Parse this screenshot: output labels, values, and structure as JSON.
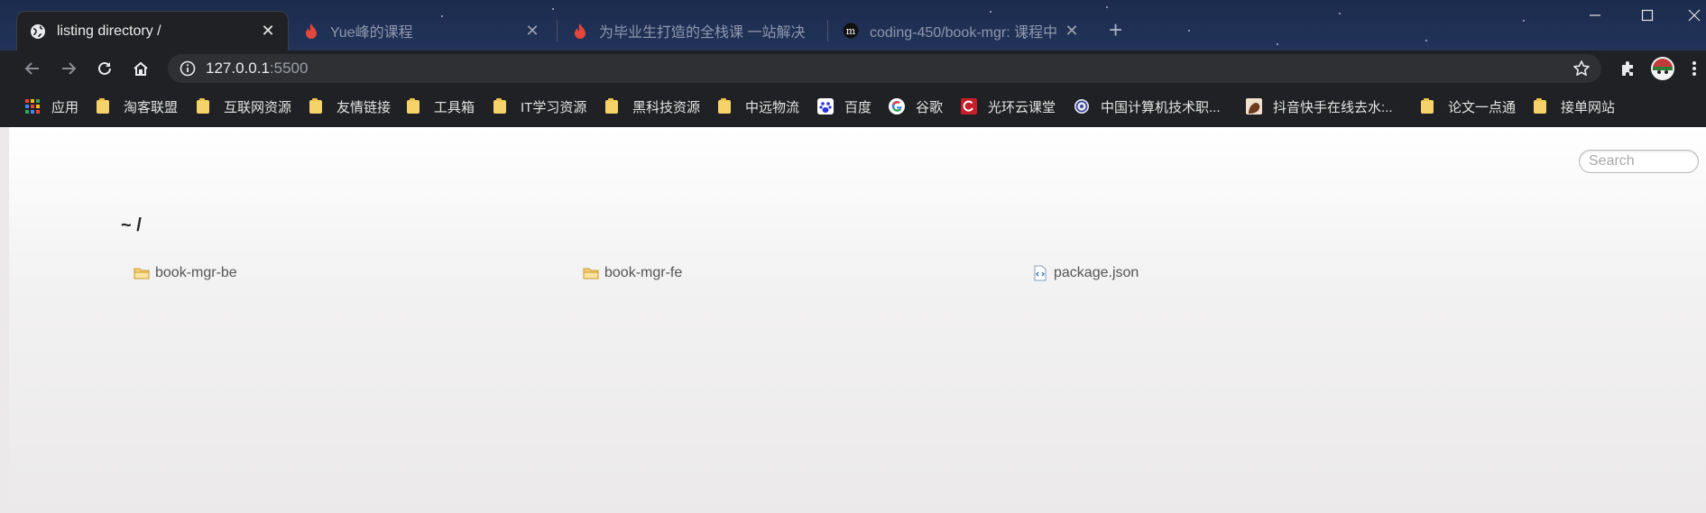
{
  "tabs": [
    {
      "title": "listing directory /",
      "icon": "globe-icon",
      "active": true
    },
    {
      "title": "Yue峰的课程",
      "icon": "flame-icon",
      "active": false
    },
    {
      "title": "为毕业生打造的全栈课 一站解决",
      "icon": "flame-icon",
      "active": false
    },
    {
      "title": "coding-450/book-mgr: 课程中",
      "icon": "coding-logo-icon",
      "active": false
    }
  ],
  "tab_close_glyph": "✕",
  "new_tab_glyph": "+",
  "address": {
    "host": "127.0.0.1",
    "port": ":5500"
  },
  "bookmarks": [
    {
      "label": "应用",
      "icon": "apps-grid-icon"
    },
    {
      "label": "淘客联盟",
      "icon": "folder-icon"
    },
    {
      "label": "互联网资源",
      "icon": "folder-icon"
    },
    {
      "label": "友情链接",
      "icon": "folder-icon"
    },
    {
      "label": "工具箱",
      "icon": "folder-icon"
    },
    {
      "label": "IT学习资源",
      "icon": "folder-icon"
    },
    {
      "label": "黑科技资源",
      "icon": "folder-icon"
    },
    {
      "label": "中远物流",
      "icon": "folder-icon"
    },
    {
      "label": "百度",
      "icon": "baidu-paw-icon"
    },
    {
      "label": "谷歌",
      "icon": "google-icon"
    },
    {
      "label": "光环云课堂",
      "icon": "red-logo-icon"
    },
    {
      "label": "中国计算机技术职...",
      "icon": "circle-logo-icon"
    },
    {
      "label": "抖音快手在线去水:..",
      "icon": "avatar-icon"
    },
    {
      "label": "论文一点通",
      "icon": "folder-icon"
    },
    {
      "label": "接单网站",
      "icon": "folder-icon"
    }
  ],
  "page": {
    "search_placeholder": "Search",
    "path": "~ /",
    "files": [
      {
        "name": "book-mgr-be",
        "type": "folder"
      },
      {
        "name": "book-mgr-fe",
        "type": "folder"
      },
      {
        "name": "package.json",
        "type": "json-file"
      }
    ]
  },
  "colors": {
    "chrome_bg": "#202124",
    "tabstrip_bg": "#1e2e52",
    "page_bg": "#ebe9e9",
    "folder_yellow": "#f5d36a"
  }
}
